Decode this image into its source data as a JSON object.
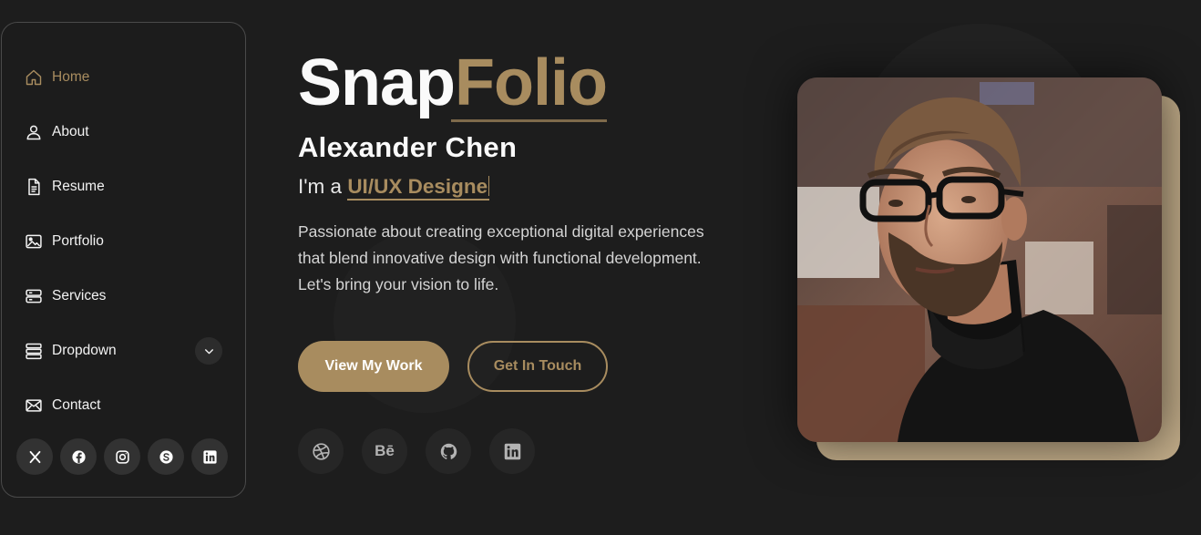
{
  "sidebar": {
    "items": [
      {
        "label": "Home",
        "icon": "home-icon"
      },
      {
        "label": "About",
        "icon": "user-icon"
      },
      {
        "label": "Resume",
        "icon": "file-icon"
      },
      {
        "label": "Portfolio",
        "icon": "image-icon"
      },
      {
        "label": "Services",
        "icon": "server-icon"
      },
      {
        "label": "Dropdown",
        "icon": "menu-stack-icon"
      },
      {
        "label": "Contact",
        "icon": "envelope-icon"
      }
    ],
    "socials": [
      "x-icon",
      "facebook-icon",
      "instagram-icon",
      "skype-icon",
      "linkedin-icon"
    ]
  },
  "hero": {
    "brand_part1": "Snap",
    "brand_part2": "Folio",
    "name": "Alexander Chen",
    "role_prefix": "I'm a ",
    "role_typed": "UI/UX Designe",
    "description": "Passionate about creating exceptional digital experiences that blend innovative design with functional development. Let's bring your vision to life.",
    "primary_button": "View My Work",
    "secondary_button": "Get In Touch",
    "socials": [
      "dribbble-icon",
      "behance-icon",
      "github-icon",
      "linkedin-icon"
    ],
    "behance_label": "Bē"
  },
  "photo": {
    "subject": "portrait-photo"
  },
  "colors": {
    "accent": "#a88c5f",
    "background": "#1d1d1d",
    "photo_backdrop": "#c0ab88"
  }
}
